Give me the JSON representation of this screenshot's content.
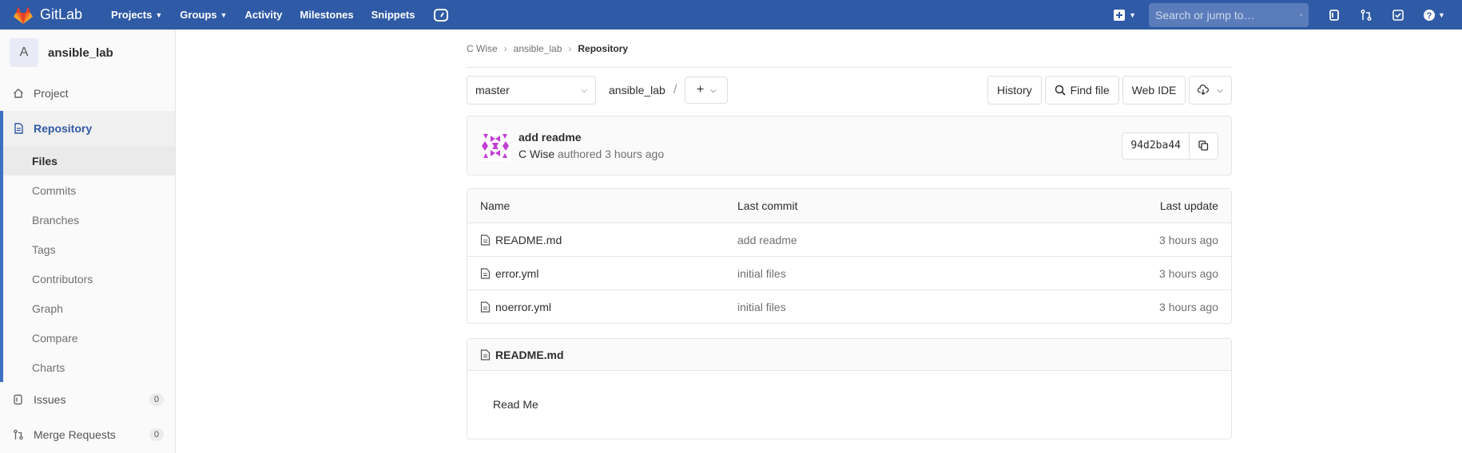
{
  "navbar": {
    "brand": "GitLab",
    "items": [
      {
        "label": "Projects",
        "has_dropdown": true
      },
      {
        "label": "Groups",
        "has_dropdown": true
      },
      {
        "label": "Activity",
        "has_dropdown": false
      },
      {
        "label": "Milestones",
        "has_dropdown": false
      },
      {
        "label": "Snippets",
        "has_dropdown": false
      }
    ],
    "search_placeholder": "Search or jump to…",
    "colors": {
      "bar": "#2f5aa6",
      "search": "#5b7cbb",
      "logo_orange": "#fc6d26",
      "logo_red": "#e24329"
    }
  },
  "sidebar": {
    "avatar_letter": "A",
    "project_name": "ansible_lab",
    "project_label": "Project",
    "repository_label": "Repository",
    "sub_items": [
      "Files",
      "Commits",
      "Branches",
      "Tags",
      "Contributors",
      "Graph",
      "Compare",
      "Charts"
    ],
    "current_sub": "Files",
    "issues_label": "Issues",
    "issues_count": "0",
    "mr_label": "Merge Requests",
    "mr_count": "0"
  },
  "breadcrumb": {
    "items": [
      "C Wise",
      "ansible_lab"
    ],
    "current": "Repository"
  },
  "toolbar": {
    "branch": "master",
    "path_root": "ansible_lab",
    "path_sep": "/",
    "add_label": "+",
    "history_label": "History",
    "find_file_label": "Find file",
    "web_ide_label": "Web IDE"
  },
  "commit": {
    "title": "add readme",
    "author": "C Wise",
    "meta": "authored 3 hours ago",
    "sha": "94d2ba44"
  },
  "file_table": {
    "headers": {
      "name": "Name",
      "last_commit": "Last commit",
      "last_update": "Last update"
    },
    "rows": [
      {
        "name": "README.md",
        "commit": "add readme",
        "updated": "3 hours ago"
      },
      {
        "name": "error.yml",
        "commit": "initial files",
        "updated": "3 hours ago"
      },
      {
        "name": "noerror.yml",
        "commit": "initial files",
        "updated": "3 hours ago"
      }
    ]
  },
  "readme": {
    "filename": "README.md",
    "content": "Read Me"
  }
}
